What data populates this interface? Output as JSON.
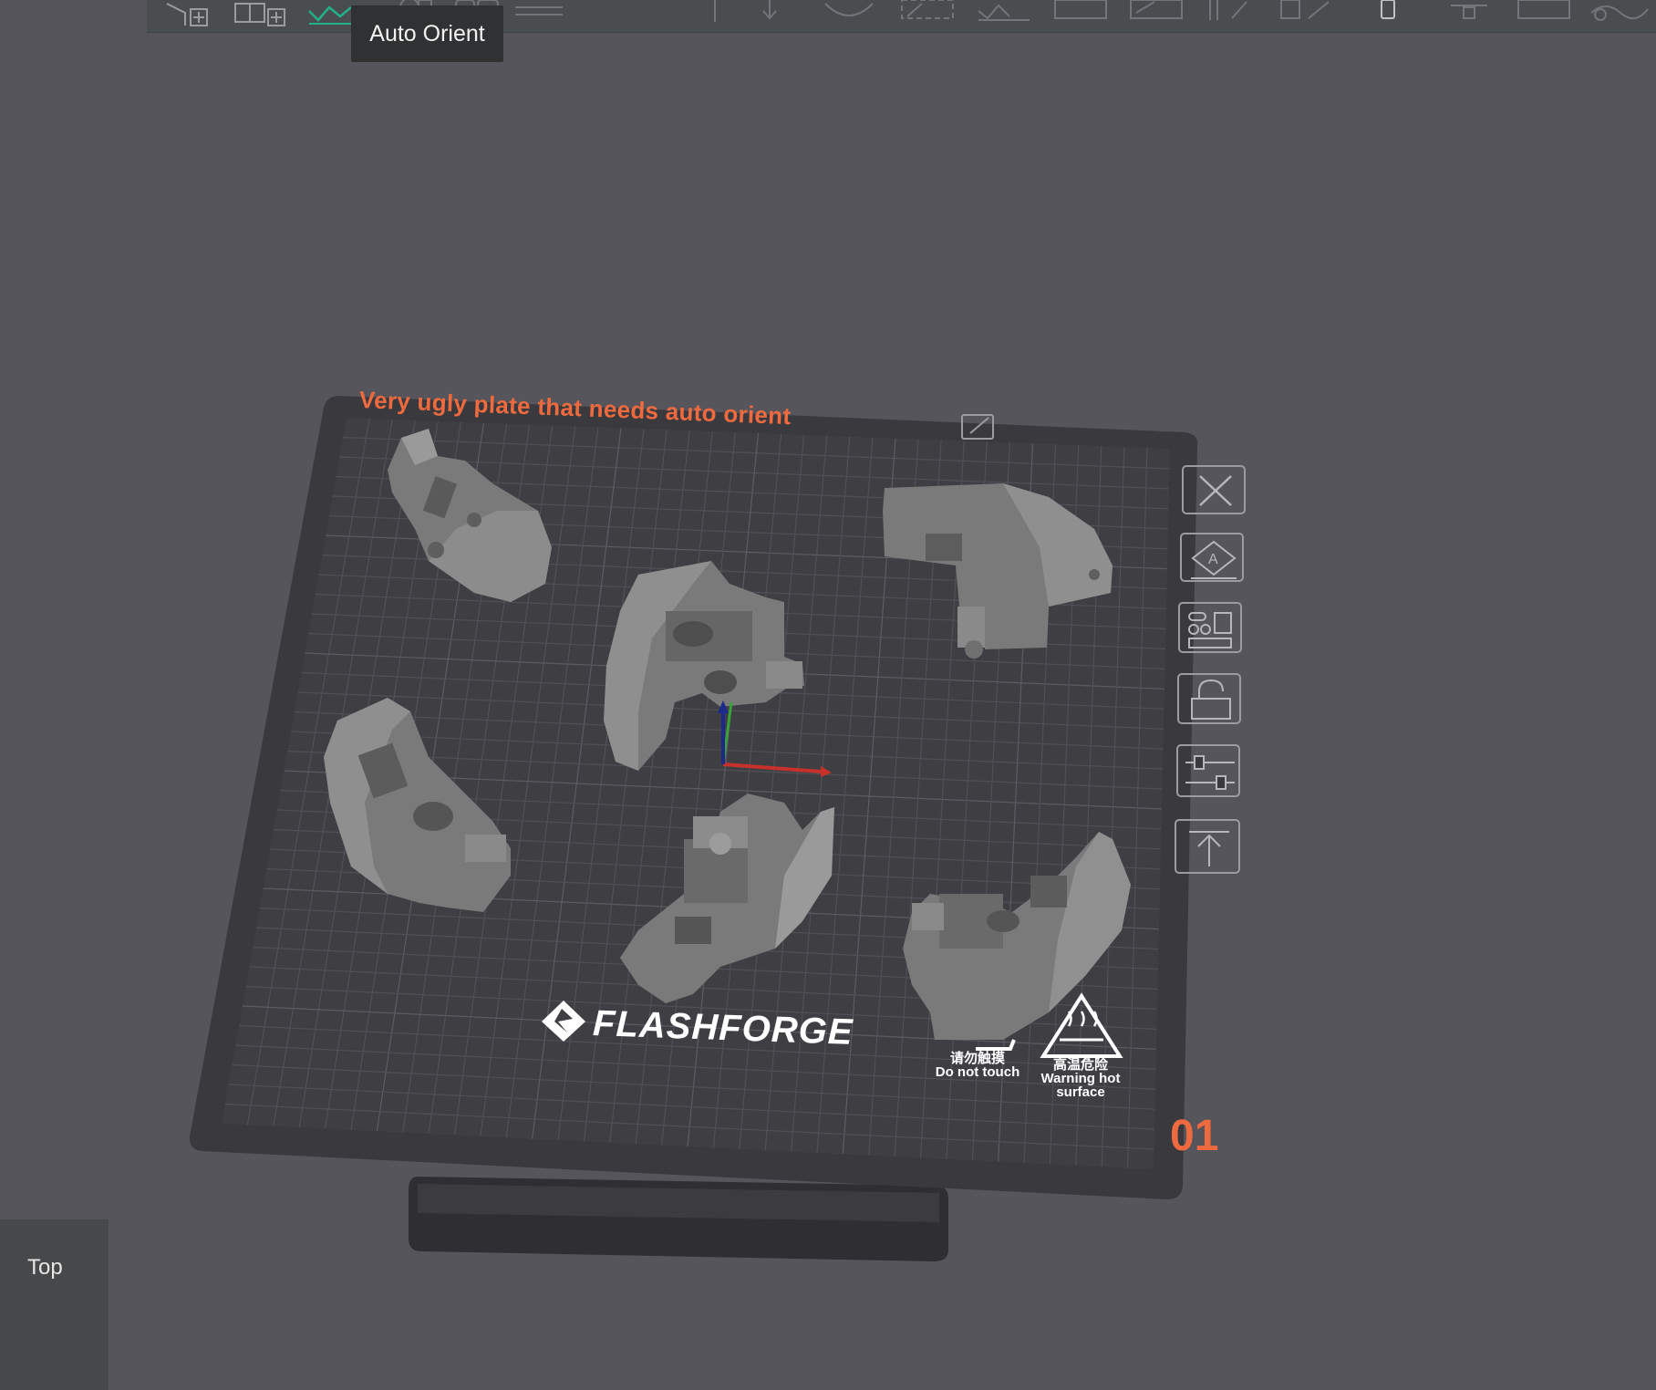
{
  "toolbar": {
    "icons": [
      "add-object-icon",
      "add-plate-icon",
      "auto-orient-icon",
      "arrange-icon",
      "split-icon",
      "cut-icon",
      "layers-icon",
      "move-icon",
      "rotate-icon",
      "scale-icon",
      "place-on-face-icon",
      "support-paint-icon",
      "seam-paint-icon",
      "measure-icon",
      "assembly-icon",
      "text-icon",
      "mesh-boolean-icon"
    ]
  },
  "tooltip": {
    "text": "Auto Orient"
  },
  "plate": {
    "title": "Very ugly plate that needs auto orient",
    "number": "01",
    "brand": "FLASHFORGE",
    "warning_left_cn": "请勿触摸",
    "warning_left_en": "Do not touch",
    "warning_right_cn": "高温危险",
    "warning_right_en": "Warning hot",
    "warning_right_en2": "surface"
  },
  "plate_tools": [
    {
      "name": "remove-plate-icon"
    },
    {
      "name": "auto-orient-plate-icon"
    },
    {
      "name": "arrange-plate-icon"
    },
    {
      "name": "lock-plate-icon"
    },
    {
      "name": "plate-settings-icon"
    },
    {
      "name": "move-plate-to-front-icon"
    }
  ],
  "view_cube": {
    "label": "Top"
  },
  "colors": {
    "background": "#55555b",
    "accent_orange": "#ef6a3e",
    "plate": "#3a3a3e",
    "model": "#7d7d7d"
  }
}
